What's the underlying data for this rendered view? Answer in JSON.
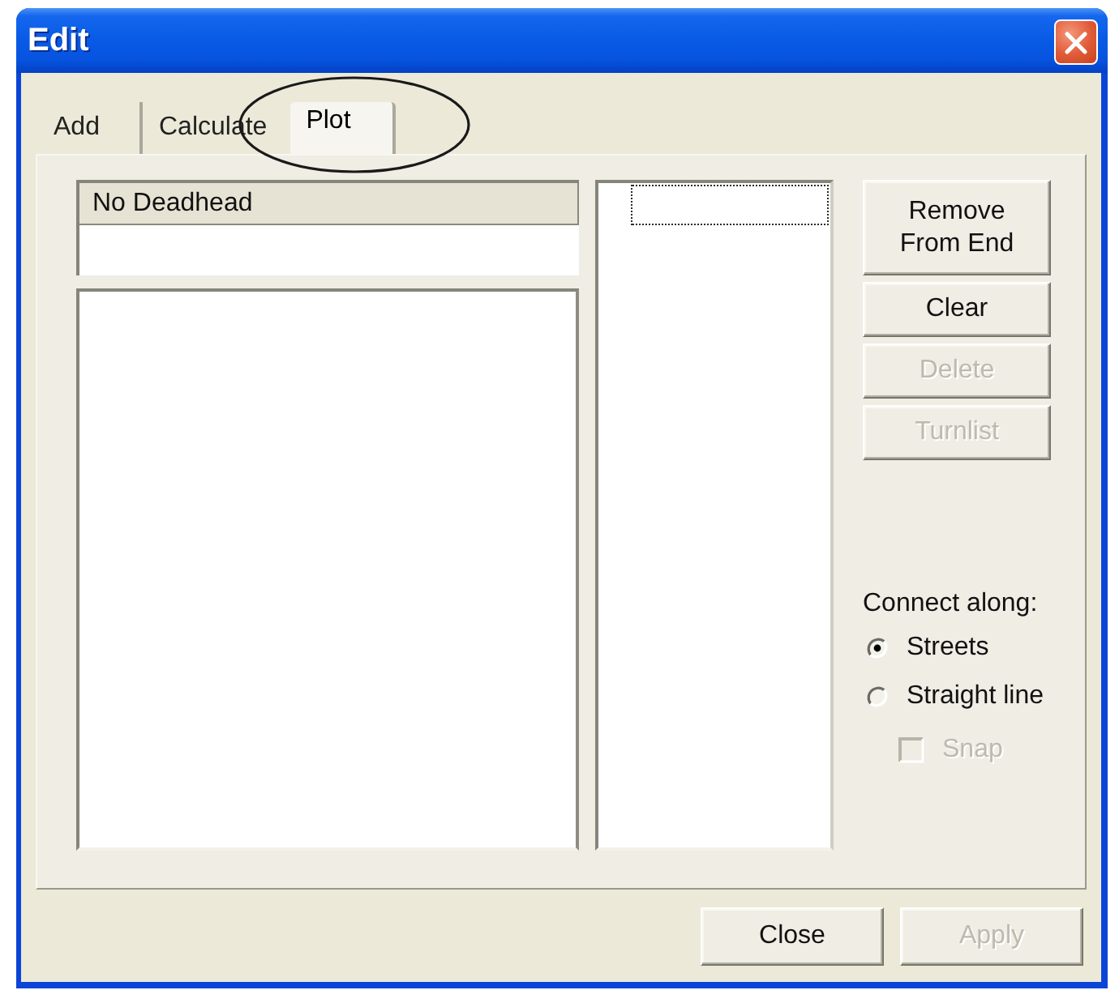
{
  "window": {
    "title": "Edit"
  },
  "tabs": [
    {
      "label": "Add",
      "selected": false,
      "circled": false
    },
    {
      "label": "Calculate",
      "selected": false,
      "circled": false
    },
    {
      "label": "Plot",
      "selected": true,
      "circled": true
    }
  ],
  "deadhead_list": {
    "header": "No Deadhead"
  },
  "middle_list": {
    "focused": true
  },
  "side_buttons": [
    {
      "label": "Remove From End",
      "disabled": false
    },
    {
      "label": "Clear",
      "disabled": false
    },
    {
      "label": "Delete",
      "disabled": true
    },
    {
      "label": "Turnlist",
      "disabled": true
    }
  ],
  "connect_along": {
    "label": "Connect along:",
    "options": [
      {
        "label": "Streets",
        "selected": true
      },
      {
        "label": "Straight line",
        "selected": false
      }
    ],
    "snap": {
      "label": "Snap",
      "checked": false,
      "disabled": true
    }
  },
  "footer_buttons": [
    {
      "label": "Close",
      "disabled": false
    },
    {
      "label": "Apply",
      "disabled": true
    }
  ]
}
